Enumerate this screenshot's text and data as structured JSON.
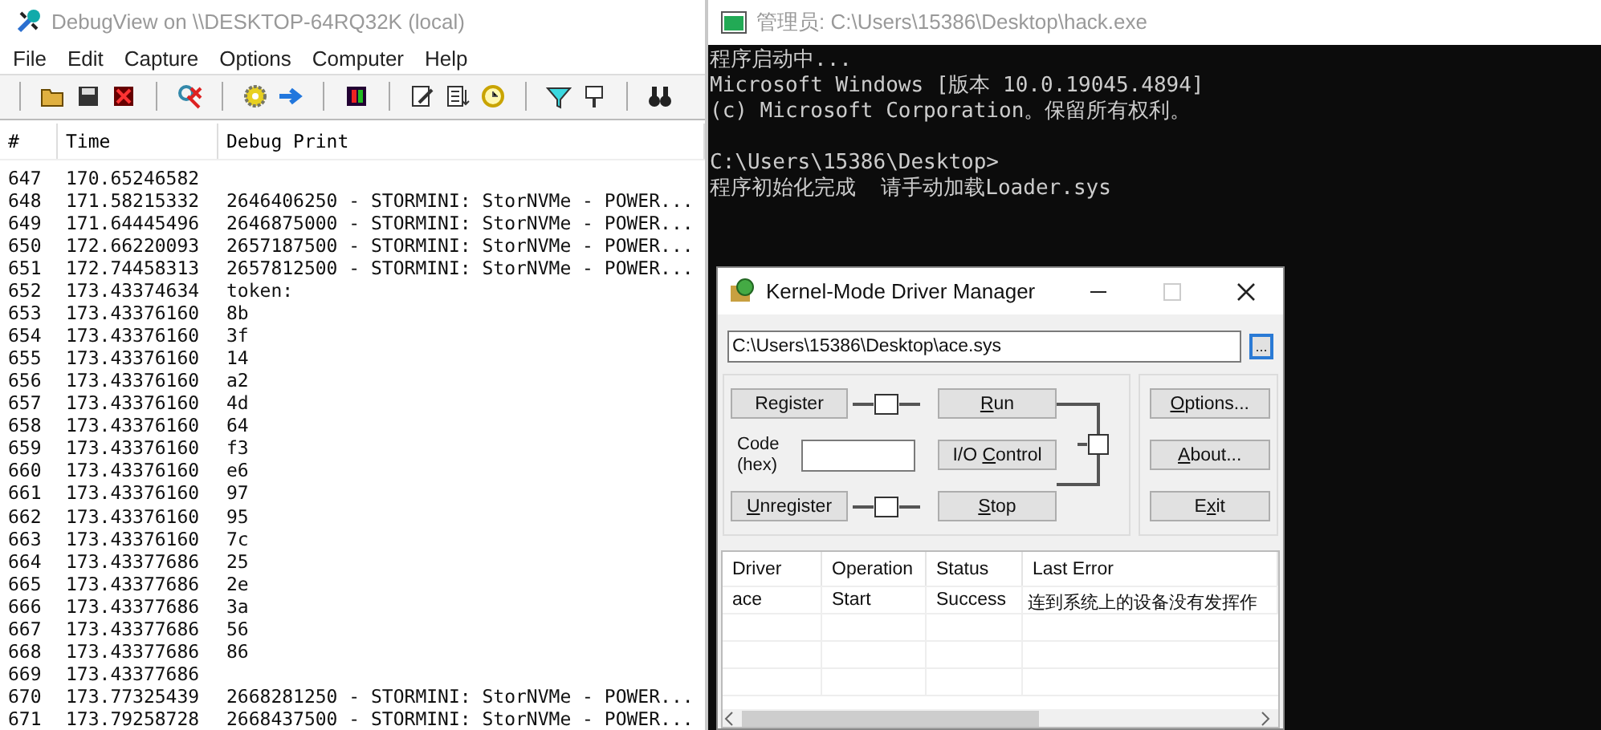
{
  "debugview": {
    "title": "DebugView on \\\\DESKTOP-64RQ32K (local)",
    "menu": [
      "File",
      "Edit",
      "Capture",
      "Options",
      "Computer",
      "Help"
    ],
    "columns": [
      "#",
      "Time",
      "Debug Print"
    ],
    "rows": [
      {
        "num": "647",
        "time": "170.65246582"
      },
      {
        "num": "648",
        "time": "171.58215332",
        "text": "2646406250 - STORMINI: StorNVMe - POWER..."
      },
      {
        "num": "649",
        "time": "171.64445496",
        "text": "2646875000 - STORMINI: StorNVMe - POWER..."
      },
      {
        "num": "650",
        "time": "172.66220093",
        "text": "2657187500 - STORMINI: StorNVMe - POWER..."
      },
      {
        "num": "651",
        "time": "172.74458313",
        "text": "2657812500 - STORMINI: StorNVMe - POWER..."
      },
      {
        "num": "652",
        "time": "173.43374634",
        "text": "token:"
      },
      {
        "num": "653",
        "time": "173.43376160",
        "text": "8b"
      },
      {
        "num": "654",
        "time": "173.43376160",
        "text": "3f"
      },
      {
        "num": "655",
        "time": "173.43376160",
        "text": "14"
      },
      {
        "num": "656",
        "time": "173.43376160",
        "text": "a2"
      },
      {
        "num": "657",
        "time": "173.43376160",
        "text": "4d"
      },
      {
        "num": "658",
        "time": "173.43376160",
        "text": "64"
      },
      {
        "num": "659",
        "time": "173.43376160",
        "text": "f3"
      },
      {
        "num": "660",
        "time": "173.43376160",
        "text": "e6"
      },
      {
        "num": "661",
        "time": "173.43376160",
        "text": "97"
      },
      {
        "num": "662",
        "time": "173.43376160",
        "text": "95"
      },
      {
        "num": "663",
        "time": "173.43376160",
        "text": "7c"
      },
      {
        "num": "664",
        "time": "173.43377686",
        "text": "25"
      },
      {
        "num": "665",
        "time": "173.43377686",
        "text": "2e"
      },
      {
        "num": "666",
        "time": "173.43377686",
        "text": "3a"
      },
      {
        "num": "667",
        "time": "173.43377686",
        "text": "56"
      },
      {
        "num": "668",
        "time": "173.43377686",
        "text": "86"
      },
      {
        "num": "669",
        "time": "173.43377686"
      },
      {
        "num": "670",
        "time": "173.77325439",
        "text": "2668281250 - STORMINI: StorNVMe - POWER..."
      },
      {
        "num": "671",
        "time": "173.79258728",
        "text": "2668437500 - STORMINI: StorNVMe - POWER..."
      }
    ]
  },
  "console": {
    "title": "管理员: C:\\Users\\15386\\Desktop\\hack.exe",
    "blocks": [
      [
        "程序启动中...",
        "Microsoft Windows [版本 10.0.19045.4894]",
        "(c) Microsoft Corporation。保留所有权利。"
      ],
      [
        "C:\\Users\\15386\\Desktop>",
        "程序初始化完成  请手动加载Loader.sys"
      ]
    ]
  },
  "driver_manager": {
    "title": "Kernel-Mode Driver Manager",
    "maximize_disabled": true,
    "path": "C:\\Users\\15386\\Desktop\\ace.sys",
    "browse": "...",
    "code_label": "Code (hex)",
    "buttons": [
      {
        "kind": "register",
        "pre": "Register"
      },
      {
        "kind": "run",
        "key": "R",
        "post": "un"
      },
      {
        "kind": "options",
        "key": "O",
        "post": "ptions..."
      },
      {
        "kind": "io",
        "pre": "I/O ",
        "key": "C",
        "post": "ontrol"
      },
      {
        "kind": "about",
        "key": "A",
        "post": "bout..."
      },
      {
        "kind": "unregister",
        "key": "U",
        "post": "nregister"
      },
      {
        "kind": "stop",
        "key": "S",
        "post": "top"
      },
      {
        "kind": "exit",
        "pre": "E",
        "key": "x",
        "post": "it"
      }
    ],
    "table": {
      "columns": [
        "Driver",
        "Operation",
        "Status",
        "Last Error"
      ],
      "rows": [
        [
          "ace",
          "Start",
          "Success",
          "连到系统上的设备没有发挥作"
        ]
      ]
    }
  }
}
